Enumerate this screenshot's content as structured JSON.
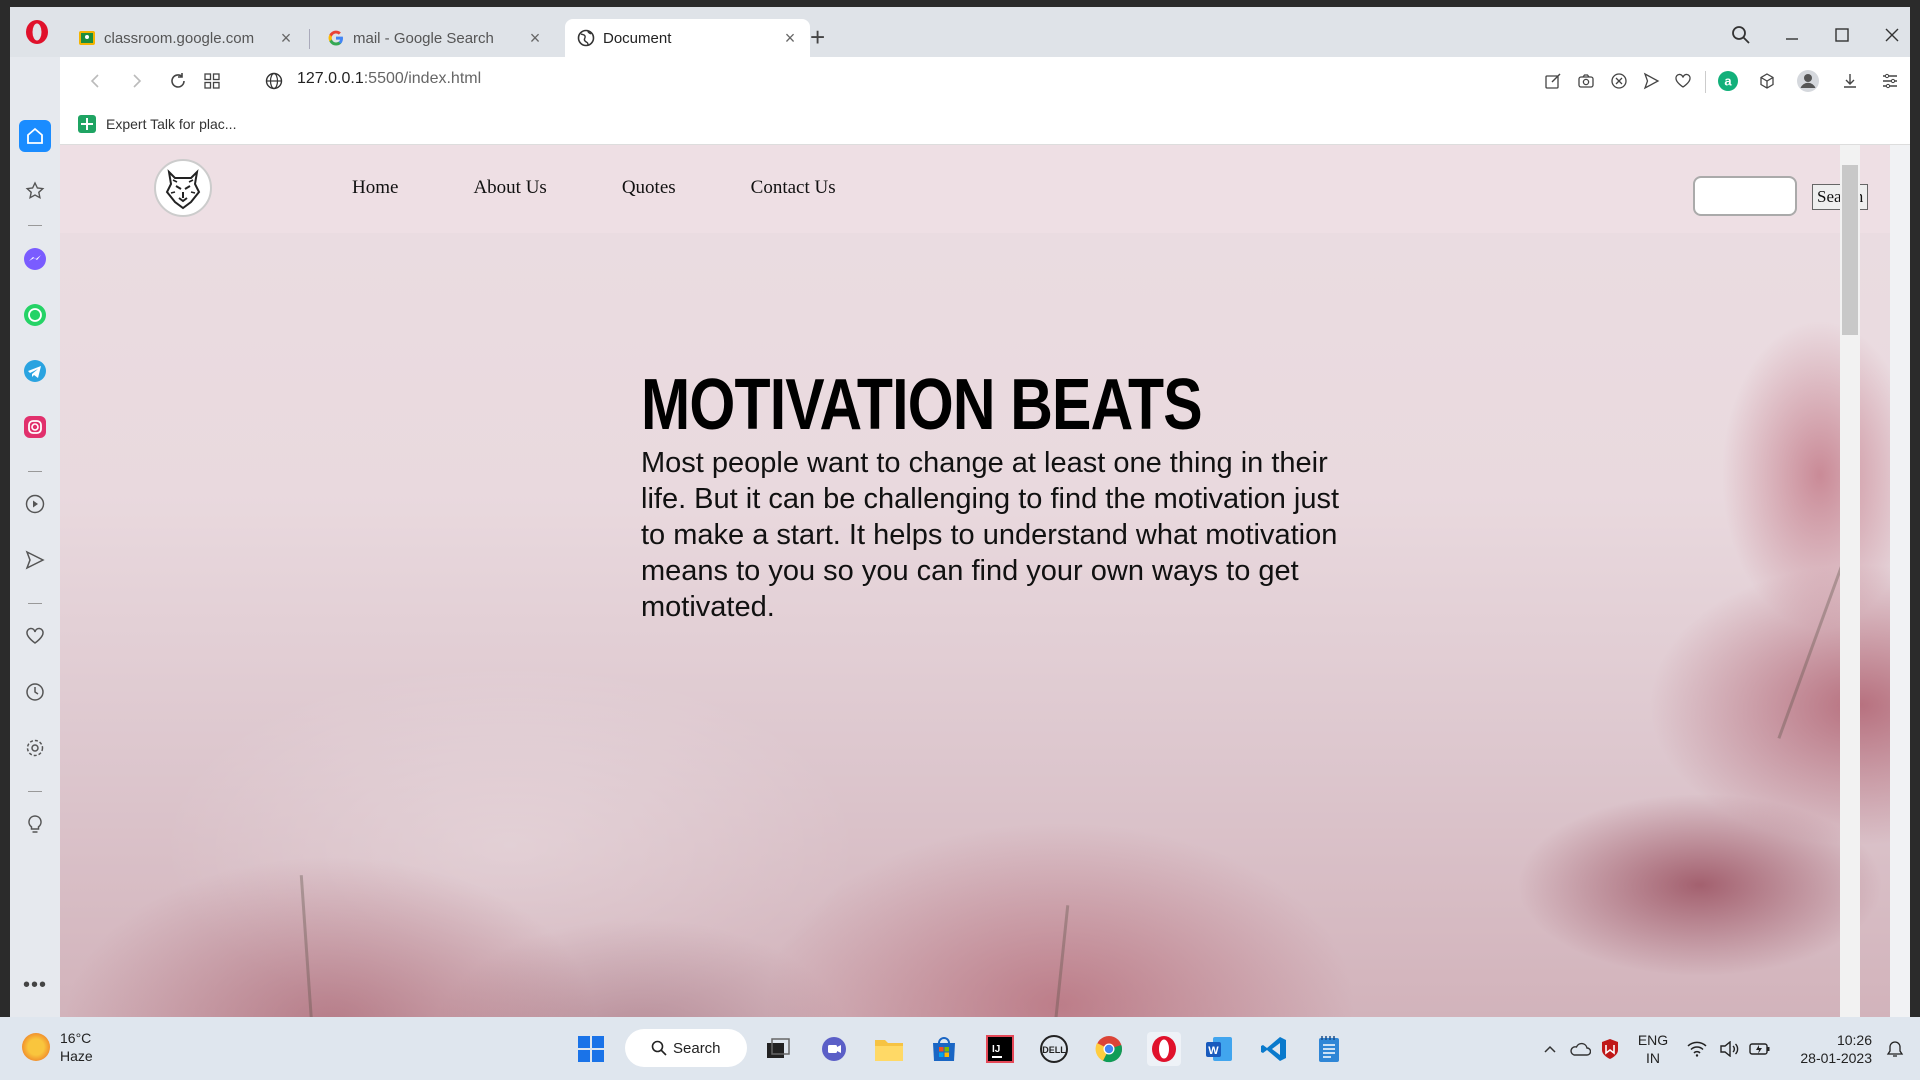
{
  "browser": {
    "tabs": [
      {
        "title": "classroom.google.com"
      },
      {
        "title": "mail - Google Search"
      },
      {
        "title": "Document"
      }
    ],
    "url_host": "127.0.0.1",
    "url_path": ":5500/index.html",
    "bookmark": "Expert Talk for plac..."
  },
  "page": {
    "nav": [
      "Home",
      "About Us",
      "Quotes",
      "Contact Us"
    ],
    "search_button": "Search",
    "search_value": "",
    "hero_title": "MOTIVATION BEATS",
    "hero_text": "Most people want to change at least one thing in their life. But it can be challenging to find the motivation just to make a start. It helps to understand what motivation means to you so you can find your own ways to get motivated."
  },
  "taskbar": {
    "temperature": "16°C",
    "weather": "Haze",
    "search_label": "Search",
    "language": "ENG",
    "region": "IN",
    "time": "10:26",
    "date": "28-01-2023"
  },
  "colors": {
    "opera_red": "#e0112b",
    "taskbar": "#dfe6ee",
    "sidebar_home": "#1a8cff"
  }
}
